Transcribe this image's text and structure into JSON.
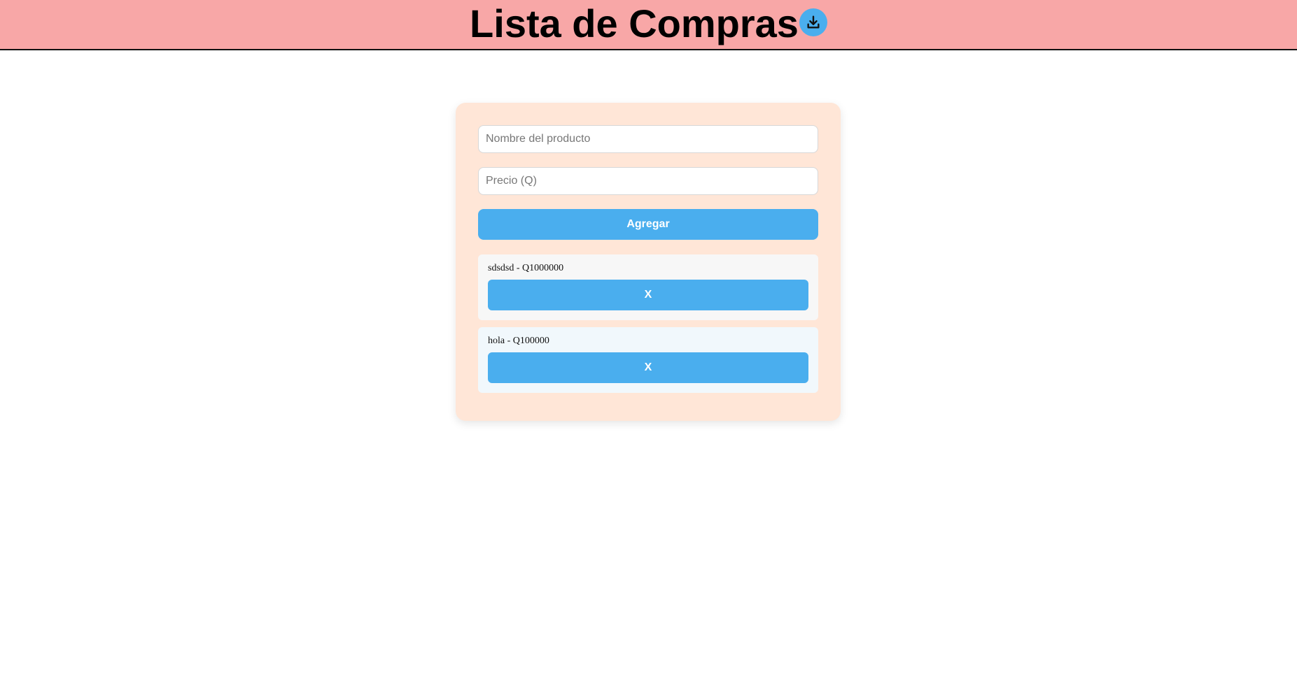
{
  "header": {
    "title": "Lista de Compras",
    "download_icon": "download-icon",
    "background_color": "#f8a7a7",
    "accent_color": "#4aaeee"
  },
  "form": {
    "product_placeholder": "Nombre del producto",
    "price_placeholder": "Precio (Q)",
    "product_value": "",
    "price_value": "",
    "add_label": "Agregar"
  },
  "items": [
    {
      "text": "sdsdsd - Q1000000",
      "remove_label": "X",
      "background": "#f7f7f7"
    },
    {
      "text": "hola - Q100000",
      "remove_label": "X",
      "background": "#f1f8fc"
    }
  ],
  "card": {
    "background_color": "#ffe6d7"
  }
}
